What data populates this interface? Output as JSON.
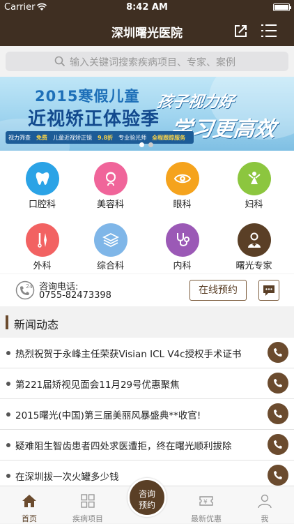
{
  "status_bar": {
    "carrier": "Carrier",
    "time": "8:42 AM"
  },
  "nav": {
    "title": "深圳曙光医院"
  },
  "search": {
    "placeholder": "输入关键词搜索疾病项目、专家、案例"
  },
  "banner": {
    "line1": "2015寒假儿童",
    "line2": "近视矫正体验季",
    "slogan1": "孩子视力好",
    "slogan2": "学习更高效",
    "pills": [
      {
        "text": "视力筛查",
        "highlight": "免费"
      },
      {
        "text": "儿童近视矫正镜",
        "highlight": "9.8折"
      },
      {
        "text": "专业验光师",
        "highlight": "全程跟踪服务"
      }
    ],
    "page_count": 2,
    "current_page": 1
  },
  "departments": [
    {
      "label": "口腔科",
      "icon": "tooth-icon",
      "color": "#2ba3e6"
    },
    {
      "label": "美容科",
      "icon": "beauty-face-icon",
      "color": "#f0659a"
    },
    {
      "label": "眼科",
      "icon": "eye-icon",
      "color": "#f5a31d"
    },
    {
      "label": "妇科",
      "icon": "female-figure-icon",
      "color": "#8cc63f"
    },
    {
      "label": "外科",
      "icon": "surgical-tools-icon",
      "color": "#f26262"
    },
    {
      "label": "综合科",
      "icon": "layers-icon",
      "color": "#7fb6e8"
    },
    {
      "label": "内科",
      "icon": "stethoscope-icon",
      "color": "#9b59b6"
    },
    {
      "label": "曙光专家",
      "icon": "doctor-icon",
      "color": "#5a3f26"
    }
  ],
  "contact": {
    "label": "咨询电话:",
    "number": "0755-82473398",
    "book_label": "在线预约"
  },
  "news": {
    "heading": "新闻动态",
    "items": [
      "热烈祝贺于永峰主任荣获Visian ICL V4c授权手术证书",
      "第221届矫视见面会11月29号优惠聚焦",
      "2015曙光(中国)第三届美丽风暴盛典**收官!",
      "疑难阻生智齿患者四处求医遭拒，终在曙光顺利拔除",
      "在深圳拔一次火罐多少钱"
    ]
  },
  "tabs": {
    "home": "首页",
    "diseases": "疾病项目",
    "consult_line1": "咨询",
    "consult_line2": "预约",
    "offers": "最新优惠",
    "me": "我"
  },
  "colors": {
    "brand": "#3f2f22",
    "accent": "#6b4b2e"
  }
}
